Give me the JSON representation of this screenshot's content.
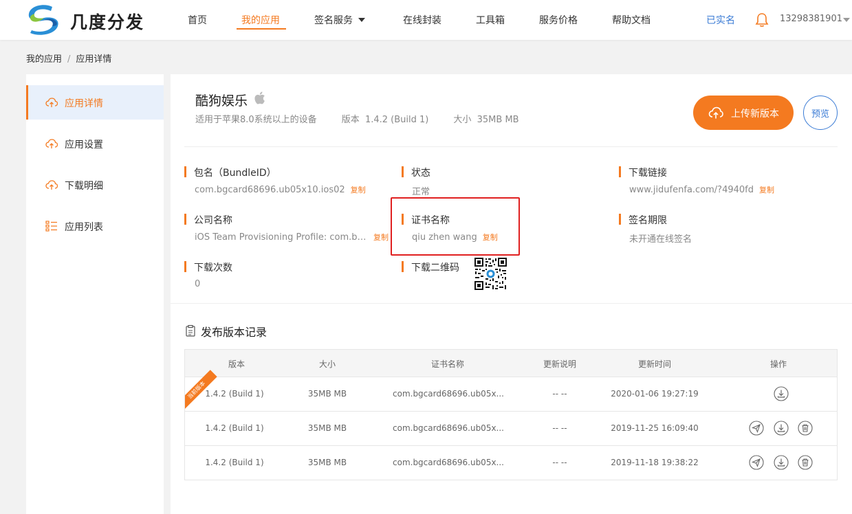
{
  "brand": {
    "name": "几度分发"
  },
  "nav": {
    "items": [
      {
        "label": "首页"
      },
      {
        "label": "我的应用"
      },
      {
        "label": "签名服务"
      },
      {
        "label": "在线封装"
      },
      {
        "label": "工具箱"
      },
      {
        "label": "服务价格"
      },
      {
        "label": "帮助文档"
      }
    ],
    "active_index": 1,
    "verified": "已实名",
    "phone": "13298381901"
  },
  "breadcrumb": {
    "items": [
      "我的应用",
      "应用详情"
    ],
    "separator": "/"
  },
  "sidebar": {
    "items": [
      {
        "label": "应用详情",
        "icon": "cloud-upload-icon"
      },
      {
        "label": "应用设置",
        "icon": "cloud-upload-icon"
      },
      {
        "label": "下载明细",
        "icon": "cloud-upload-icon"
      },
      {
        "label": "应用列表",
        "icon": "list-icon"
      }
    ],
    "active_index": 0
  },
  "app": {
    "name": "酷狗娱乐",
    "platform_icon": "apple-icon",
    "compat": "适用于苹果8.0系统以上的设备",
    "version_label": "版本",
    "version": "1.4.2 (Build 1)",
    "size_label": "大小",
    "size": "35MB MB",
    "upload_label": "上传新版本",
    "preview_label": "预览"
  },
  "fields": {
    "bundle_id": {
      "label": "包名（BundleID）",
      "value": "com.bgcard68696.ub05x10.ios02",
      "copy": "复制"
    },
    "status": {
      "label": "状态",
      "value": "正常"
    },
    "download_link": {
      "label": "下载链接",
      "value": "www.jidufenfa.com/?4940fd",
      "copy": "复制"
    },
    "company": {
      "label": "公司名称",
      "value": "iOS Team Provisioning Profile: com.bg...",
      "copy": "复制"
    },
    "cert_name": {
      "label": "证书名称",
      "value": "qiu zhen wang",
      "copy": "复制"
    },
    "sign_period": {
      "label": "签名期限",
      "value": "未开通在线签名"
    },
    "download_count": {
      "label": "下载次数",
      "value": "0"
    },
    "qr": {
      "label": "下载二维码"
    }
  },
  "records": {
    "title": "发布版本记录",
    "columns": [
      "版本",
      "大小",
      "证书名称",
      "更新说明",
      "更新时间",
      "操作"
    ],
    "current_badge": "当前版本",
    "rows": [
      {
        "version": "1.4.2 (Build 1)",
        "size": "35MB MB",
        "cert": "com.bgcard68696.ub05x...",
        "notes": "-- --",
        "time": "2020-01-06 19:27:19",
        "current": true
      },
      {
        "version": "1.4.2 (Build 1)",
        "size": "35MB MB",
        "cert": "com.bgcard68696.ub05x...",
        "notes": "-- --",
        "time": "2019-11-25 16:09:40",
        "current": false
      },
      {
        "version": "1.4.2 (Build 1)",
        "size": "35MB MB",
        "cert": "com.bgcard68696.ub05x...",
        "notes": "-- --",
        "time": "2019-11-18 19:38:22",
        "current": false
      }
    ]
  },
  "colors": {
    "accent": "#f47a20",
    "link": "#3a7bd5",
    "highlight": "#e02020"
  }
}
